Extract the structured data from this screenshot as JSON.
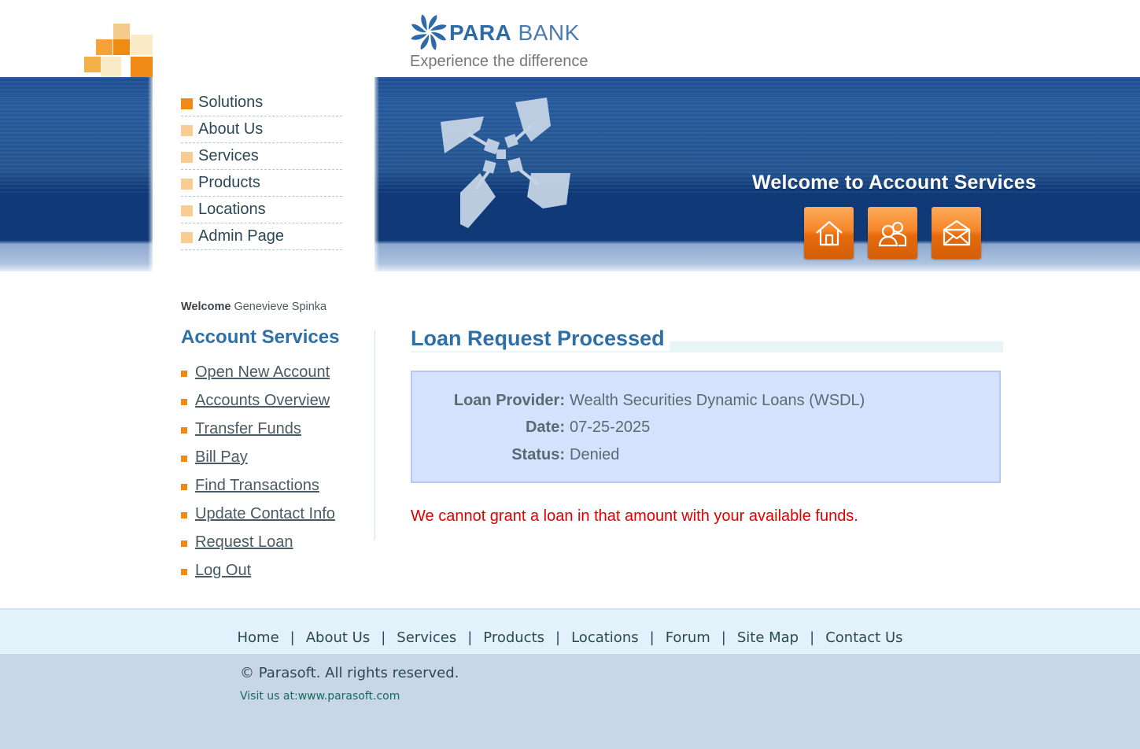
{
  "brand": {
    "name_part1": "PARA",
    "name_part2": "BANK",
    "tagline": "Experience the difference"
  },
  "header_nav": [
    {
      "label": "Solutions"
    },
    {
      "label": "About Us"
    },
    {
      "label": "Services"
    },
    {
      "label": "Products"
    },
    {
      "label": "Locations"
    },
    {
      "label": "Admin Page"
    }
  ],
  "banner": {
    "welcome_text": "Welcome to Account Services",
    "buttons": [
      "home-icon",
      "contact-people-icon",
      "envelope-icon"
    ]
  },
  "sidebar": {
    "welcome_label": "Welcome",
    "user_name": "Genevieve Spinka",
    "title": "Account Services",
    "items": [
      {
        "label": "Open New Account"
      },
      {
        "label": "Accounts Overview"
      },
      {
        "label": "Transfer Funds"
      },
      {
        "label": "Bill Pay"
      },
      {
        "label": "Find Transactions"
      },
      {
        "label": "Update Contact Info"
      },
      {
        "label": "Request Loan"
      },
      {
        "label": "Log Out"
      }
    ]
  },
  "main": {
    "title": "Loan Request Processed",
    "fields": [
      {
        "label": "Loan Provider:",
        "value": "Wealth Securities Dynamic Loans (WSDL)"
      },
      {
        "label": "Date:",
        "value": "07-25-2025"
      },
      {
        "label": "Status:",
        "value": "Denied"
      }
    ],
    "error_message": "We cannot grant a loan in that amount with your available funds."
  },
  "footer": {
    "links": [
      "Home",
      "About Us",
      "Services",
      "Products",
      "Locations",
      "Forum",
      "Site Map",
      "Contact Us"
    ],
    "separator": "|",
    "copyright": "© Parasoft. All rights reserved.",
    "visit_prefix": "Visit us at:",
    "visit_link": "www.parasoft.com"
  },
  "colors": {
    "accent_orange": "#ef8a14",
    "title_blue": "#2f6fa8",
    "error_red": "#e00000",
    "result_box_bg": "#d5e2fe"
  }
}
